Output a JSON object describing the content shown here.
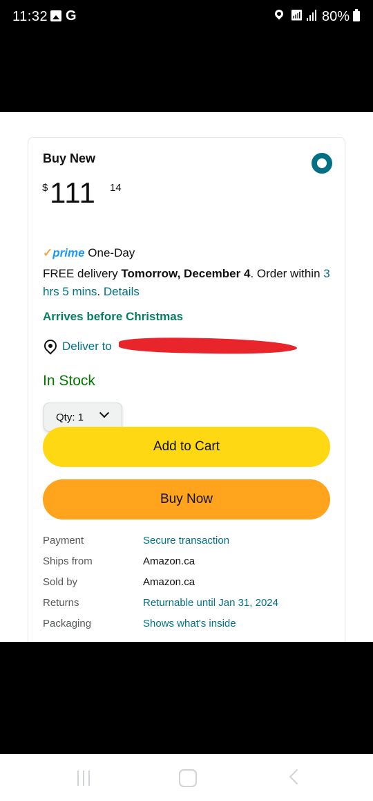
{
  "status_bar": {
    "time": "11:32",
    "g_label": "G",
    "battery": "80%"
  },
  "card": {
    "buy_new": "Buy New",
    "price": {
      "symbol": "$",
      "whole": "111",
      "fraction": "14"
    },
    "prime": {
      "check": "✓",
      "word": "prime",
      "speed": "One-Day"
    },
    "delivery": {
      "free": "FREE delivery",
      "date": "Tomorrow, December 4",
      "mid": ". Order within",
      "countdown": "3 hrs 5 mins",
      "after": ".",
      "details": "Details"
    },
    "arrives": "Arrives before Christmas",
    "deliver_to": "Deliver to",
    "stock": "In Stock",
    "qty": "Qty: 1",
    "add_to_cart": "Add to Cart",
    "buy_now": "Buy Now",
    "info": [
      {
        "label": "Payment",
        "value": "Secure transaction",
        "link": true
      },
      {
        "label": "Ships from",
        "value": "Amazon.ca",
        "link": false
      },
      {
        "label": "Sold by",
        "value": "Amazon.ca",
        "link": false
      },
      {
        "label": "Returns",
        "value": "Returnable until Jan 31, 2024",
        "link": true
      },
      {
        "label": "Packaging",
        "value": "Shows what's inside",
        "link": true
      }
    ]
  },
  "colors": {
    "add_to_cart": "#ffd814",
    "buy_now": "#ffa41c",
    "in_stock": "#007600",
    "link": "#007185",
    "arrives": "#067d62"
  }
}
